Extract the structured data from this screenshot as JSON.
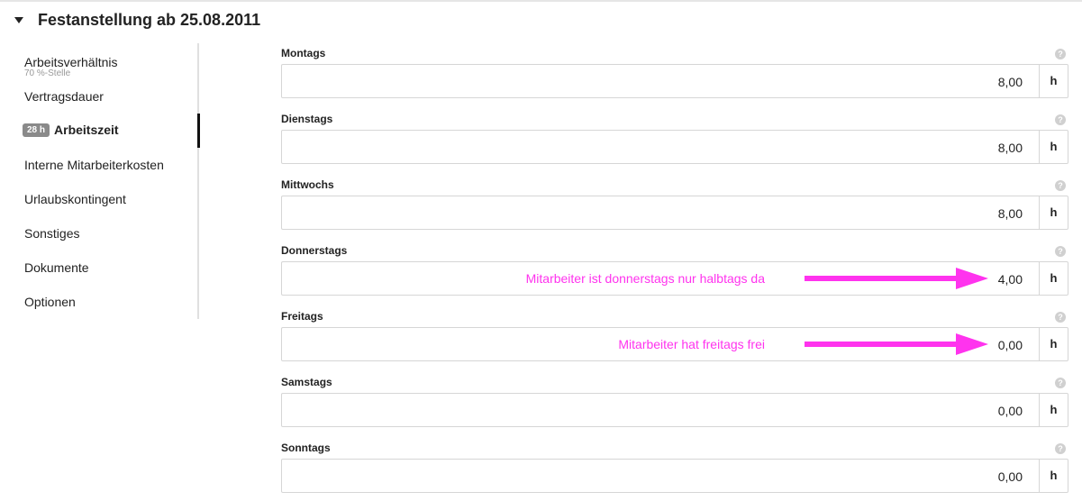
{
  "section": {
    "title": "Festanstellung ab 25.08.2011",
    "caret_icon": "caret-down-icon"
  },
  "sidebar": {
    "items": [
      {
        "label": "Arbeitsverhältnis",
        "sub": "70 %-Stelle"
      },
      {
        "label": "Vertragsdauer"
      },
      {
        "label": "Arbeitszeit",
        "badge": "28 h",
        "active": true
      },
      {
        "label": "Interne Mitarbeiterkosten"
      },
      {
        "label": "Urlaubskontingent"
      },
      {
        "label": "Sonstiges"
      },
      {
        "label": "Dokumente"
      },
      {
        "label": "Optionen"
      }
    ]
  },
  "form": {
    "help_glyph": "?",
    "unit": "h",
    "fields": [
      {
        "label": "Montags",
        "value": "8,00"
      },
      {
        "label": "Dienstags",
        "value": "8,00"
      },
      {
        "label": "Mittwochs",
        "value": "8,00"
      },
      {
        "label": "Donnerstags",
        "value": "4,00",
        "annotation": "Mitarbeiter ist donnerstags nur halbtags da"
      },
      {
        "label": "Freitags",
        "value": "0,00",
        "annotation": "Mitarbeiter hat freitags frei"
      },
      {
        "label": "Samstags",
        "value": "0,00"
      },
      {
        "label": "Sonntags",
        "value": "0,00"
      }
    ]
  },
  "colors": {
    "annotation": "#ff33ee",
    "active_indicator": "#111111",
    "badge": "#8a8a8a"
  }
}
